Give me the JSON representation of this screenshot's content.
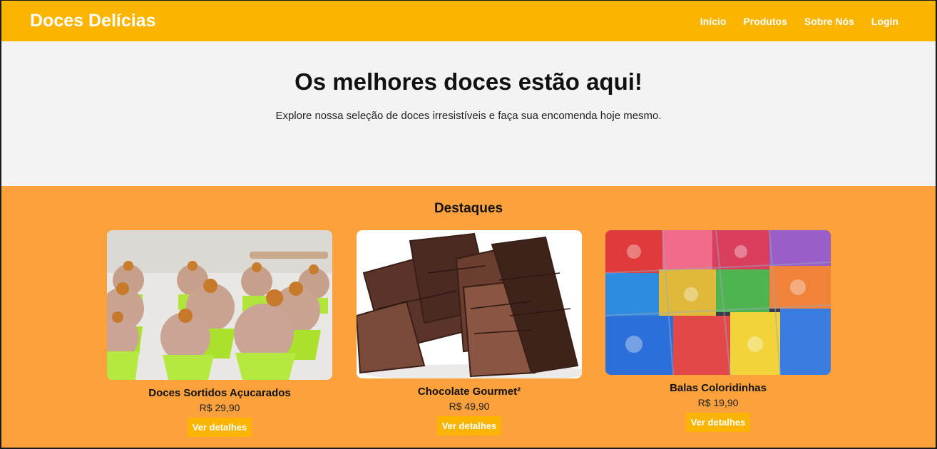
{
  "header": {
    "brand": "Doces Delícias",
    "nav": [
      "Início",
      "Produtos",
      "Sobre Nós",
      "Login"
    ]
  },
  "hero": {
    "title": "Os melhores doces estão aqui!",
    "subtitle": "Explore nossa seleção de doces irresistíveis e faça sua encomenda hoje mesmo."
  },
  "featured": {
    "title": "Destaques",
    "products": [
      {
        "name": "Doces Sortidos Açucarados",
        "price": "R$ 29,90",
        "button": "Ver detalhes"
      },
      {
        "name": "Chocolate Gourmet²",
        "price": "R$ 49,90",
        "button": "Ver detalhes"
      },
      {
        "name": "Balas Coloridinhas",
        "price": "R$ 19,90",
        "button": "Ver detalhes"
      }
    ]
  },
  "colors": {
    "header_bg": "#fbb400",
    "hero_bg": "#f3f3f3",
    "featured_bg": "#fca13b",
    "button_bg": "#fbb400"
  }
}
